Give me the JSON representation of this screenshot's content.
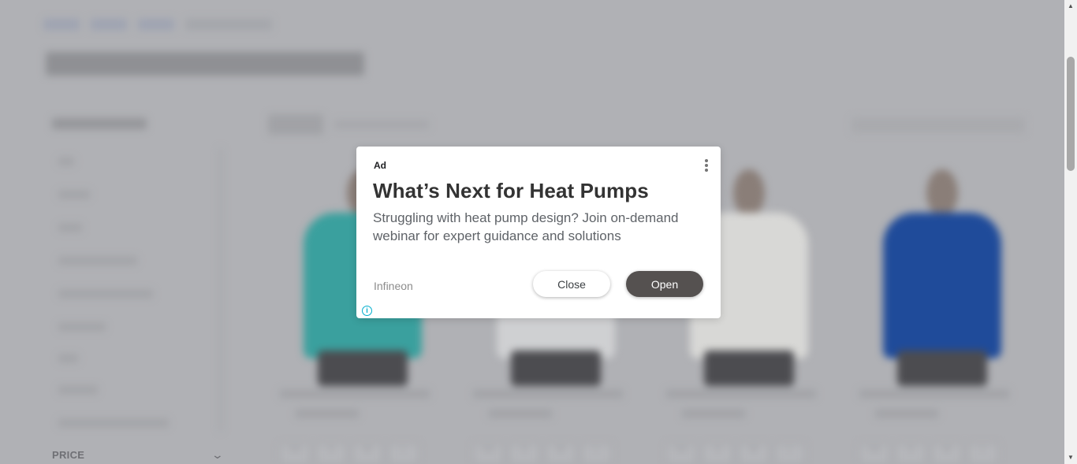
{
  "background_page": {
    "filters": {
      "price_label": "PRICE"
    },
    "products": [
      {
        "color": "#3aa09e",
        "sizes": [
          "XS",
          "S",
          "M",
          "L"
        ]
      },
      {
        "color": "#cfd0d2",
        "sizes": [
          "XS",
          "S",
          "M",
          "L"
        ]
      },
      {
        "color": "#d8d8d6",
        "sizes": [
          "XS",
          "S",
          "M",
          "L"
        ]
      },
      {
        "color": "#1f4b9a",
        "sizes": [
          "XS",
          "S",
          "M",
          "L"
        ]
      }
    ]
  },
  "ad": {
    "badge": "Ad",
    "headline": "What’s Next for Heat Pumps",
    "body": "Struggling with heat pump design? Join on-demand webinar for expert guidance and solutions",
    "advertiser": "Infineon",
    "close_label": "Close",
    "open_label": "Open",
    "info_icon": "i"
  },
  "icons": {
    "menu": "more-vert-icon",
    "info": "info-icon",
    "chevron": "chevron-down-icon"
  },
  "colors": {
    "overlay": "#b0b1b5",
    "open_button": "#555150",
    "info_accent": "#00aecd"
  }
}
